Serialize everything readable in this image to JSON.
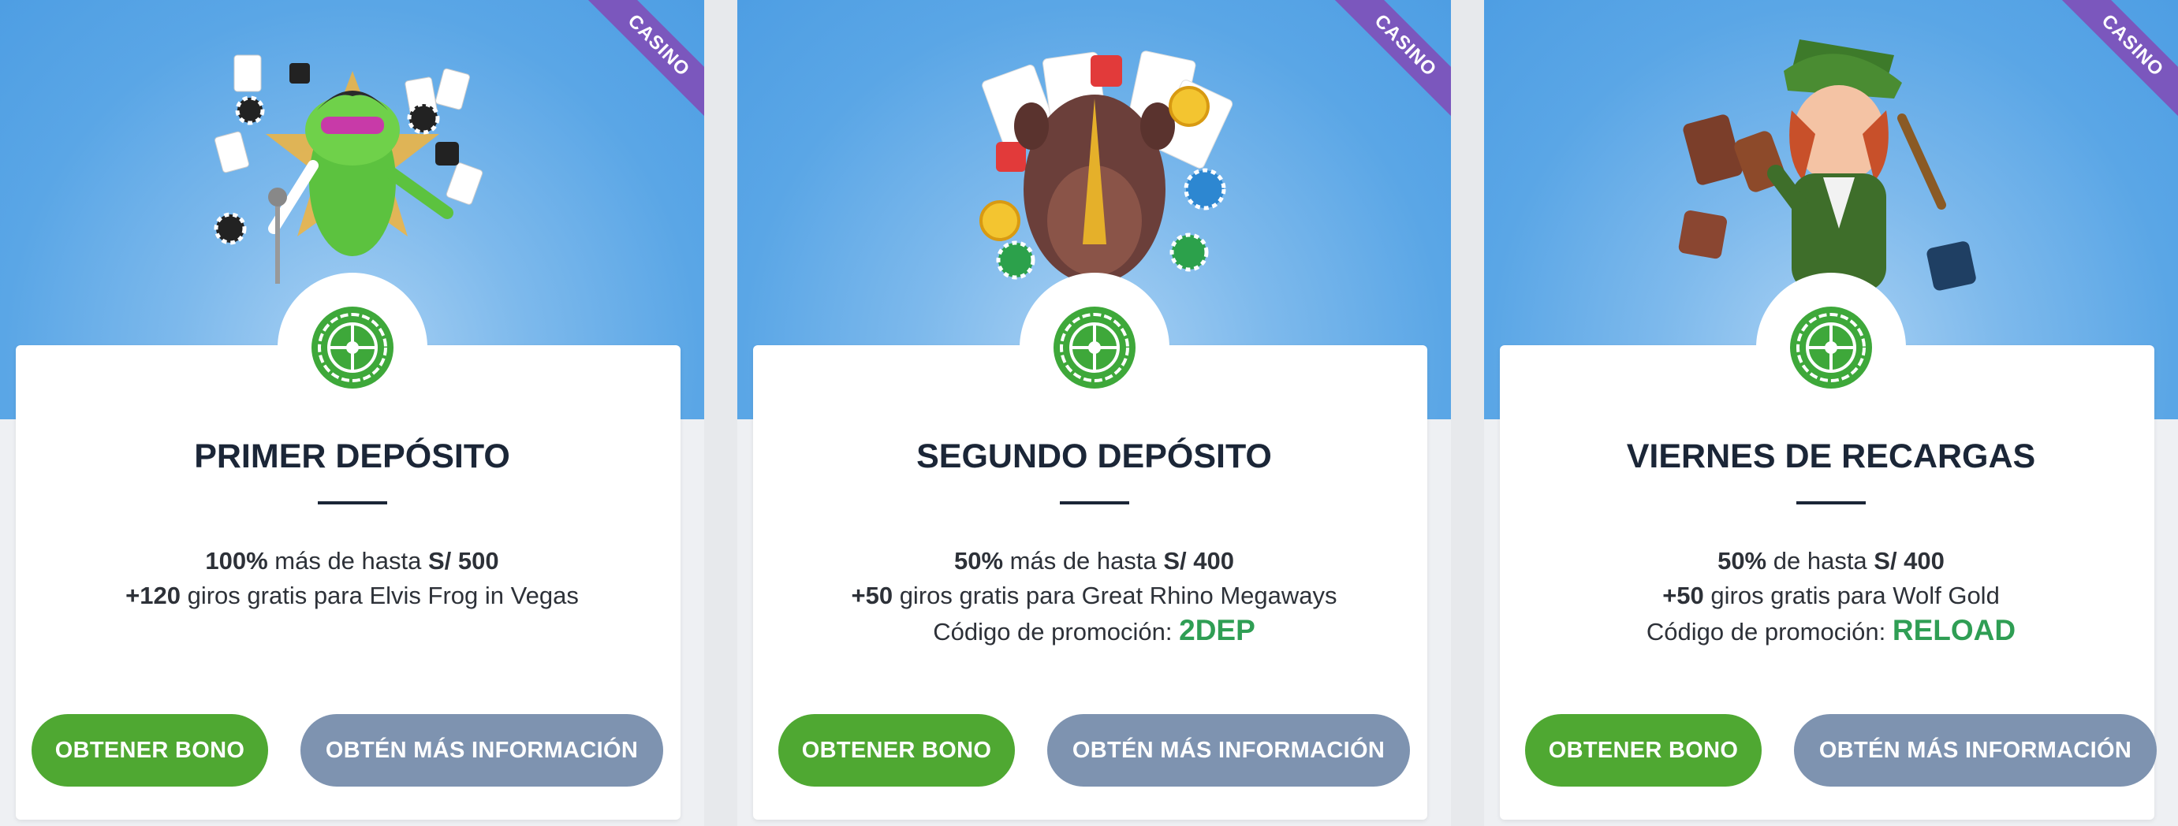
{
  "cards": [
    {
      "ribbon": "CASINO",
      "art_icon": "elvis-frog-art",
      "badge_icon": "roulette-icon",
      "title": "PRIMER DEPÓSITO",
      "line1": {
        "strong1": "100%",
        "text1": " más de hasta ",
        "strong2": "S/ 500"
      },
      "line2": {
        "strong1": "+120",
        "text1": " giros gratis para Elvis Frog in Vegas"
      },
      "promo": null,
      "primary_button": "OBTENER BONO",
      "info_button": "OBTÉN MÁS INFORMACIÓN"
    },
    {
      "ribbon": "CASINO",
      "art_icon": "rhino-art",
      "badge_icon": "roulette-icon",
      "title": "SEGUNDO DEPÓSITO",
      "line1": {
        "strong1": "50%",
        "text1": " más de hasta ",
        "strong2": "S/ 400"
      },
      "line2": {
        "strong1": "+50",
        "text1": " giros gratis para Great Rhino Megaways"
      },
      "promo": {
        "label": "Código de promoción: ",
        "code": "2DEP"
      },
      "primary_button": "OBTENER BONO",
      "info_button": "OBTÉN MÁS INFORMACIÓN"
    },
    {
      "ribbon": "CASINO",
      "art_icon": "leprechaun-art",
      "badge_icon": "roulette-icon",
      "title": "VIERNES DE RECARGAS",
      "line1": {
        "strong1": "50%",
        "text1": " de hasta ",
        "strong2": "S/ 400"
      },
      "line2": {
        "strong1": "+50",
        "text1": " giros gratis para Wolf Gold"
      },
      "promo": {
        "label": "Código de promoción: ",
        "code": "RELOAD"
      },
      "primary_button": "OBTENER BONO",
      "info_button": "OBTÉN MÁS INFORMACIÓN"
    }
  ],
  "colors": {
    "primary_button": "#4fa832",
    "info_button": "#7e93b0",
    "ribbon": "#7b57bd",
    "promo_code": "#2f9e54",
    "hero_blue": "#5aa6e6"
  }
}
